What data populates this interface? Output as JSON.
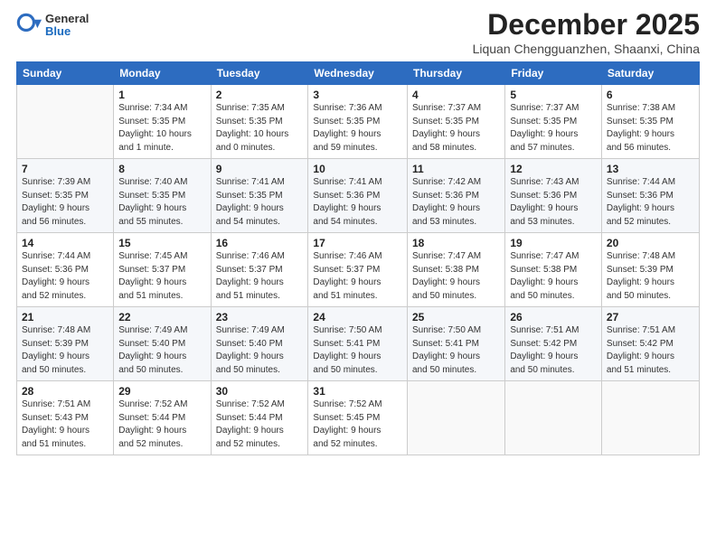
{
  "header": {
    "logo_general": "General",
    "logo_blue": "Blue",
    "month_title": "December 2025",
    "location": "Liquan Chengguanzhen, Shaanxi, China"
  },
  "calendar": {
    "columns": [
      "Sunday",
      "Monday",
      "Tuesday",
      "Wednesday",
      "Thursday",
      "Friday",
      "Saturday"
    ],
    "weeks": [
      [
        {
          "day": "",
          "info": ""
        },
        {
          "day": "1",
          "info": "Sunrise: 7:34 AM\nSunset: 5:35 PM\nDaylight: 10 hours\nand 1 minute."
        },
        {
          "day": "2",
          "info": "Sunrise: 7:35 AM\nSunset: 5:35 PM\nDaylight: 10 hours\nand 0 minutes."
        },
        {
          "day": "3",
          "info": "Sunrise: 7:36 AM\nSunset: 5:35 PM\nDaylight: 9 hours\nand 59 minutes."
        },
        {
          "day": "4",
          "info": "Sunrise: 7:37 AM\nSunset: 5:35 PM\nDaylight: 9 hours\nand 58 minutes."
        },
        {
          "day": "5",
          "info": "Sunrise: 7:37 AM\nSunset: 5:35 PM\nDaylight: 9 hours\nand 57 minutes."
        },
        {
          "day": "6",
          "info": "Sunrise: 7:38 AM\nSunset: 5:35 PM\nDaylight: 9 hours\nand 56 minutes."
        }
      ],
      [
        {
          "day": "7",
          "info": "Sunrise: 7:39 AM\nSunset: 5:35 PM\nDaylight: 9 hours\nand 56 minutes."
        },
        {
          "day": "8",
          "info": "Sunrise: 7:40 AM\nSunset: 5:35 PM\nDaylight: 9 hours\nand 55 minutes."
        },
        {
          "day": "9",
          "info": "Sunrise: 7:41 AM\nSunset: 5:35 PM\nDaylight: 9 hours\nand 54 minutes."
        },
        {
          "day": "10",
          "info": "Sunrise: 7:41 AM\nSunset: 5:36 PM\nDaylight: 9 hours\nand 54 minutes."
        },
        {
          "day": "11",
          "info": "Sunrise: 7:42 AM\nSunset: 5:36 PM\nDaylight: 9 hours\nand 53 minutes."
        },
        {
          "day": "12",
          "info": "Sunrise: 7:43 AM\nSunset: 5:36 PM\nDaylight: 9 hours\nand 53 minutes."
        },
        {
          "day": "13",
          "info": "Sunrise: 7:44 AM\nSunset: 5:36 PM\nDaylight: 9 hours\nand 52 minutes."
        }
      ],
      [
        {
          "day": "14",
          "info": "Sunrise: 7:44 AM\nSunset: 5:36 PM\nDaylight: 9 hours\nand 52 minutes."
        },
        {
          "day": "15",
          "info": "Sunrise: 7:45 AM\nSunset: 5:37 PM\nDaylight: 9 hours\nand 51 minutes."
        },
        {
          "day": "16",
          "info": "Sunrise: 7:46 AM\nSunset: 5:37 PM\nDaylight: 9 hours\nand 51 minutes."
        },
        {
          "day": "17",
          "info": "Sunrise: 7:46 AM\nSunset: 5:37 PM\nDaylight: 9 hours\nand 51 minutes."
        },
        {
          "day": "18",
          "info": "Sunrise: 7:47 AM\nSunset: 5:38 PM\nDaylight: 9 hours\nand 50 minutes."
        },
        {
          "day": "19",
          "info": "Sunrise: 7:47 AM\nSunset: 5:38 PM\nDaylight: 9 hours\nand 50 minutes."
        },
        {
          "day": "20",
          "info": "Sunrise: 7:48 AM\nSunset: 5:39 PM\nDaylight: 9 hours\nand 50 minutes."
        }
      ],
      [
        {
          "day": "21",
          "info": "Sunrise: 7:48 AM\nSunset: 5:39 PM\nDaylight: 9 hours\nand 50 minutes."
        },
        {
          "day": "22",
          "info": "Sunrise: 7:49 AM\nSunset: 5:40 PM\nDaylight: 9 hours\nand 50 minutes."
        },
        {
          "day": "23",
          "info": "Sunrise: 7:49 AM\nSunset: 5:40 PM\nDaylight: 9 hours\nand 50 minutes."
        },
        {
          "day": "24",
          "info": "Sunrise: 7:50 AM\nSunset: 5:41 PM\nDaylight: 9 hours\nand 50 minutes."
        },
        {
          "day": "25",
          "info": "Sunrise: 7:50 AM\nSunset: 5:41 PM\nDaylight: 9 hours\nand 50 minutes."
        },
        {
          "day": "26",
          "info": "Sunrise: 7:51 AM\nSunset: 5:42 PM\nDaylight: 9 hours\nand 50 minutes."
        },
        {
          "day": "27",
          "info": "Sunrise: 7:51 AM\nSunset: 5:42 PM\nDaylight: 9 hours\nand 51 minutes."
        }
      ],
      [
        {
          "day": "28",
          "info": "Sunrise: 7:51 AM\nSunset: 5:43 PM\nDaylight: 9 hours\nand 51 minutes."
        },
        {
          "day": "29",
          "info": "Sunrise: 7:52 AM\nSunset: 5:44 PM\nDaylight: 9 hours\nand 52 minutes."
        },
        {
          "day": "30",
          "info": "Sunrise: 7:52 AM\nSunset: 5:44 PM\nDaylight: 9 hours\nand 52 minutes."
        },
        {
          "day": "31",
          "info": "Sunrise: 7:52 AM\nSunset: 5:45 PM\nDaylight: 9 hours\nand 52 minutes."
        },
        {
          "day": "",
          "info": ""
        },
        {
          "day": "",
          "info": ""
        },
        {
          "day": "",
          "info": ""
        }
      ]
    ]
  }
}
